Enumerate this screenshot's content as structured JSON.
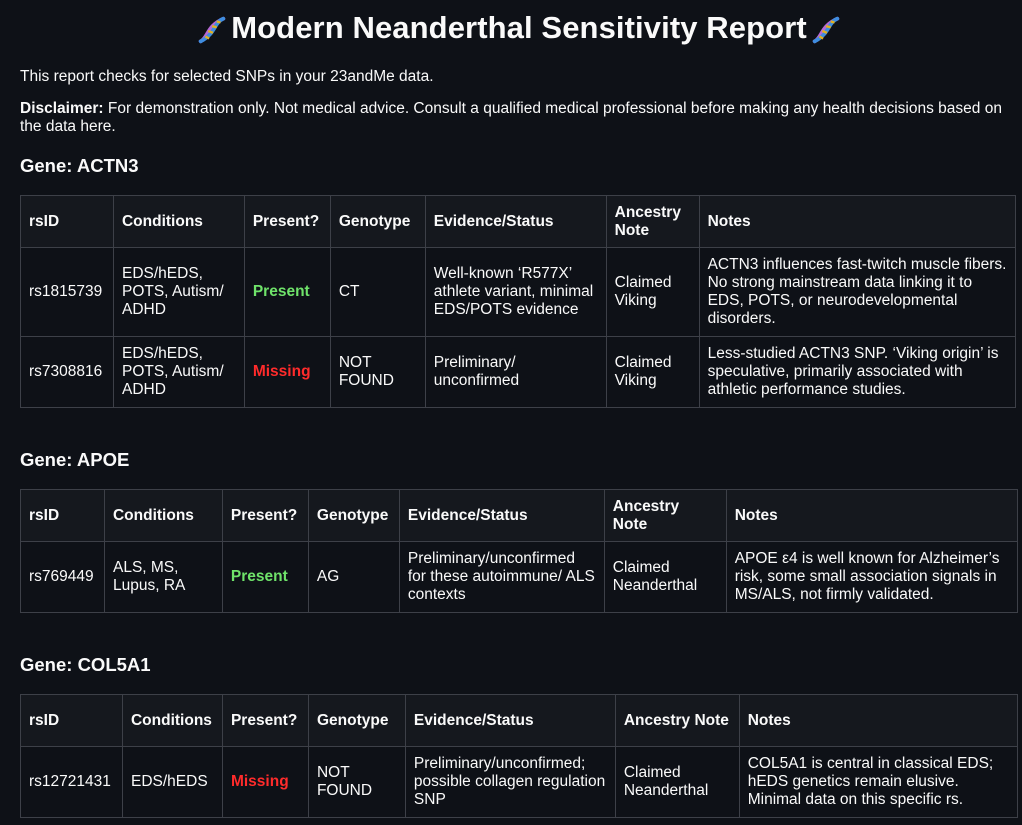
{
  "title": "Modern Neanderthal Sensitivity Report",
  "title_icon": "dna-icon",
  "intro": "This report checks for selected SNPs in your 23andMe data.",
  "disclaimer": {
    "label": "Disclaimer:",
    "text": "For demonstration only. Not medical advice. Consult a qualified medical professional before making any health decisions based on the data here."
  },
  "headers": {
    "rsid": "rsID",
    "conditions": "Conditions",
    "present": "Present?",
    "genotype": "Genotype",
    "evidence": "Evidence/Status",
    "ancestry": "Ancestry Note",
    "notes": "Notes"
  },
  "colors": {
    "background": "#0e1117",
    "present": "#6fe36a",
    "missing": "#ff2b2b",
    "border": "#3d4048"
  },
  "genes": [
    {
      "heading": "Gene: ACTN3",
      "rows": [
        {
          "rsid": "rs1815739",
          "conditions": "EDS/hEDS, POTS, Autism/ ADHD",
          "present": "Present",
          "genotype": "CT",
          "evidence": "Well-known ‘R577X’ athlete variant, minimal EDS/POTS evidence",
          "ancestry": "Claimed Viking",
          "notes": "ACTN3 influences fast-twitch muscle fibers. No strong mainstream data linking it to EDS, POTS, or neurodevelopmental disorders."
        },
        {
          "rsid": "rs7308816",
          "conditions": "EDS/hEDS, POTS, Autism/ ADHD",
          "present": "Missing",
          "genotype": "NOT FOUND",
          "evidence": "Preliminary/ unconfirmed",
          "ancestry": "Claimed Viking",
          "notes": "Less-studied ACTN3 SNP. ‘Viking origin’ is speculative, primarily associated with athletic performance studies."
        }
      ]
    },
    {
      "heading": "Gene: APOE",
      "rows": [
        {
          "rsid": "rs769449",
          "conditions": "ALS, MS, Lupus, RA",
          "present": "Present",
          "genotype": "AG",
          "evidence": "Preliminary/unconfirmed for these autoimmune/ ALS contexts",
          "ancestry": "Claimed Neanderthal",
          "notes": "APOE ε4 is well known for Alzheimer’s risk, some small association signals in MS/ALS, not firmly validated."
        }
      ]
    },
    {
      "heading": "Gene: COL5A1",
      "rows": [
        {
          "rsid": "rs12721431",
          "conditions": "EDS/hEDS",
          "present": "Missing",
          "genotype": "NOT FOUND",
          "evidence": "Preliminary/unconfirmed; possible collagen regulation SNP",
          "ancestry": "Claimed Neanderthal",
          "notes": "COL5A1 is central in classical EDS; hEDS genetics remain elusive. Minimal data on this specific rs."
        }
      ]
    }
  ]
}
